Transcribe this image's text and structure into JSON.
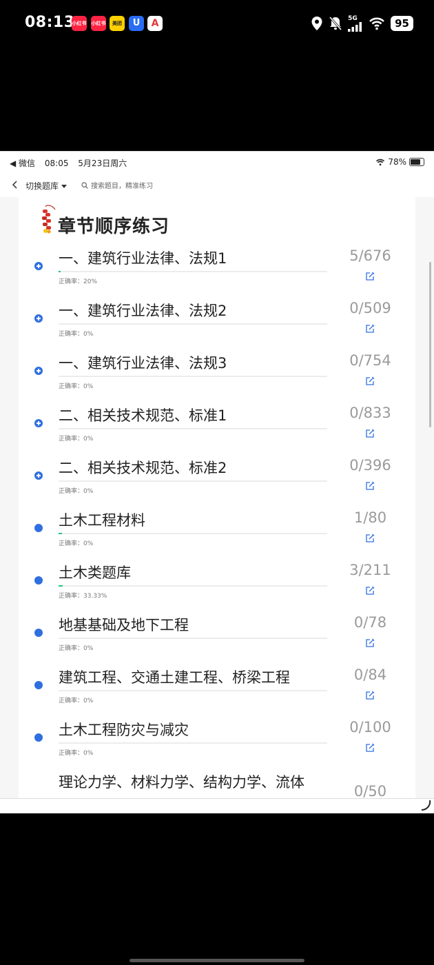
{
  "outer_status": {
    "time": "08:13",
    "apps": [
      "小红书",
      "小红书",
      "美团",
      "U",
      "A"
    ],
    "network": "5G",
    "battery": "95"
  },
  "inner_status": {
    "back_app": "◀ 微信",
    "time": "08:05",
    "date": "5月23日周六",
    "battery": "78%"
  },
  "nav": {
    "switch_label": "切换题库",
    "search_placeholder": "搜索题目，精准练习"
  },
  "heading": "章节顺序练习",
  "chapters": [
    {
      "title": "一、建筑行业法律、法规1",
      "accuracy": "正确率：20%",
      "count": "5/676",
      "progress": 0.0074,
      "icon": "plus"
    },
    {
      "title": "一、建筑行业法律、法规2",
      "accuracy": "正确率：0%",
      "count": "0/509",
      "progress": 0,
      "icon": "plus"
    },
    {
      "title": "一、建筑行业法律、法规3",
      "accuracy": "正确率：0%",
      "count": "0/754",
      "progress": 0,
      "icon": "plus"
    },
    {
      "title": "二、相关技术规范、标准1",
      "accuracy": "正确率：0%",
      "count": "0/833",
      "progress": 0,
      "icon": "plus"
    },
    {
      "title": "二、相关技术规范、标准2",
      "accuracy": "正确率：0%",
      "count": "0/396",
      "progress": 0,
      "icon": "plus"
    },
    {
      "title": "土木工程材料",
      "accuracy": "正确率：0%",
      "count": "1/80",
      "progress": 0.0125,
      "icon": "dot"
    },
    {
      "title": "土木类题库",
      "accuracy": "正确率：33.33%",
      "count": "3/211",
      "progress": 0.0142,
      "icon": "dot"
    },
    {
      "title": "地基基础及地下工程",
      "accuracy": "正确率：0%",
      "count": "0/78",
      "progress": 0,
      "icon": "dot"
    },
    {
      "title": "建筑工程、交通土建工程、桥梁工程",
      "accuracy": "正确率：0%",
      "count": "0/84",
      "progress": 0,
      "icon": "dot"
    },
    {
      "title": "土木工程防灾与减灾",
      "accuracy": "正确率：0%",
      "count": "0/100",
      "progress": 0,
      "icon": "dot"
    },
    {
      "title": "理论力学、材料力学、结构力学、流体",
      "accuracy": "",
      "count": "0/50",
      "progress": 0,
      "icon": "none"
    }
  ],
  "colors": {
    "accent": "#2f6fe0",
    "progress": "#27c47f",
    "count_text": "#9a9a9a"
  }
}
